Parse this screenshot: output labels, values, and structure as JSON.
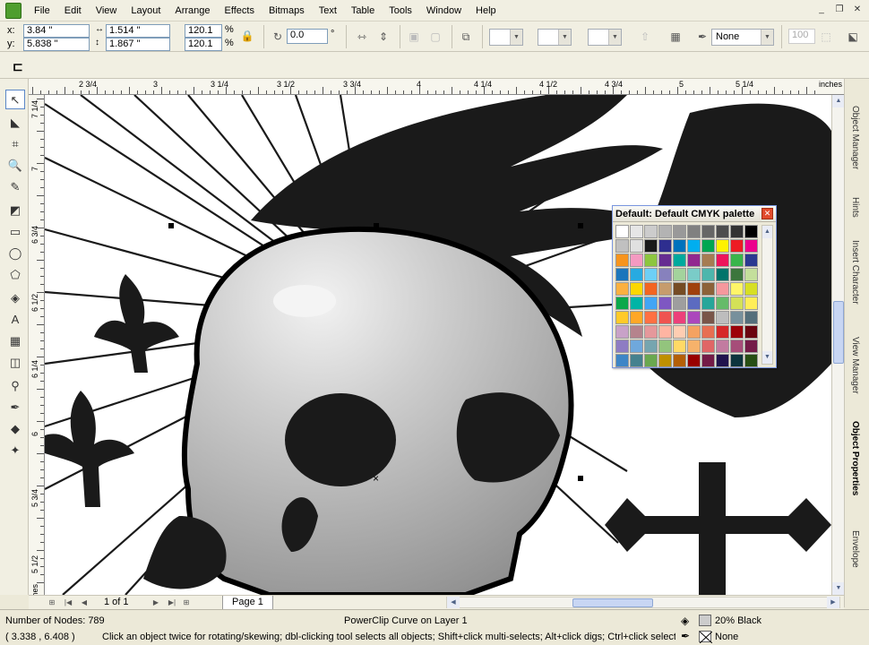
{
  "menu": [
    "File",
    "Edit",
    "View",
    "Layout",
    "Arrange",
    "Effects",
    "Bitmaps",
    "Text",
    "Table",
    "Tools",
    "Window",
    "Help"
  ],
  "window_controls": [
    "_",
    "❐",
    "✕"
  ],
  "propbar": {
    "x_label": "x:",
    "x": "3.84 \"",
    "y_label": "y:",
    "y": "5.838 \"",
    "w": "1.514 \"",
    "h": "1.867 \"",
    "scale_x": "120.1",
    "scale_y": "120.1",
    "pct": "%",
    "rotation": "0.0",
    "deg": "°",
    "outline": "None",
    "x_scale_value": "100"
  },
  "toolbox_icons": [
    "pick-tool",
    "shape-tool",
    "crop-tool",
    "zoom-tool",
    "freehand-tool",
    "smart-fill-tool",
    "rectangle-tool",
    "ellipse-tool",
    "polygon-tool",
    "basic-shapes-tool",
    "text-tool",
    "table-tool",
    "interactive-tool",
    "eyedropper-tool",
    "outline-tool",
    "fill-tool",
    "interactive-fill-tool"
  ],
  "ruler": {
    "h_labels": [
      "2 3/4",
      "3",
      "3 1/4",
      "3 1/2",
      "3 3/4",
      "4",
      "4 1/4",
      "4 1/2",
      "4 3/4",
      "5",
      "5 1/4",
      "inches"
    ],
    "v_labels": [
      "7 1/4",
      "7",
      "6 3/4",
      "6 1/2",
      "6 1/4",
      "6",
      "5 3/4",
      "5 1/2",
      "inches"
    ]
  },
  "palette": {
    "title": "Default: Default CMYK palette",
    "close": "✕"
  },
  "dockers": [
    "Object Manager",
    "Hints",
    "Insert Character",
    "View Manager",
    "Object Properties",
    "Envelope"
  ],
  "pagenav": {
    "count": "1 of 1",
    "page_tab": "Page 1"
  },
  "status": {
    "nodes": "Number of Nodes: 789",
    "object": "PowerClip Curve on Layer 1",
    "fill": "20% Black",
    "coords": "( 3.338 , 6.408 )",
    "hint": "Click an object twice for rotating/skewing; dbl-clicking tool selects all objects; Shift+click multi-selects; Alt+click digs; Ctrl+click selects in a ...",
    "outline": "None"
  },
  "colors": {
    "fill_swatch": "#cccccc",
    "accent": "#316ac5"
  }
}
